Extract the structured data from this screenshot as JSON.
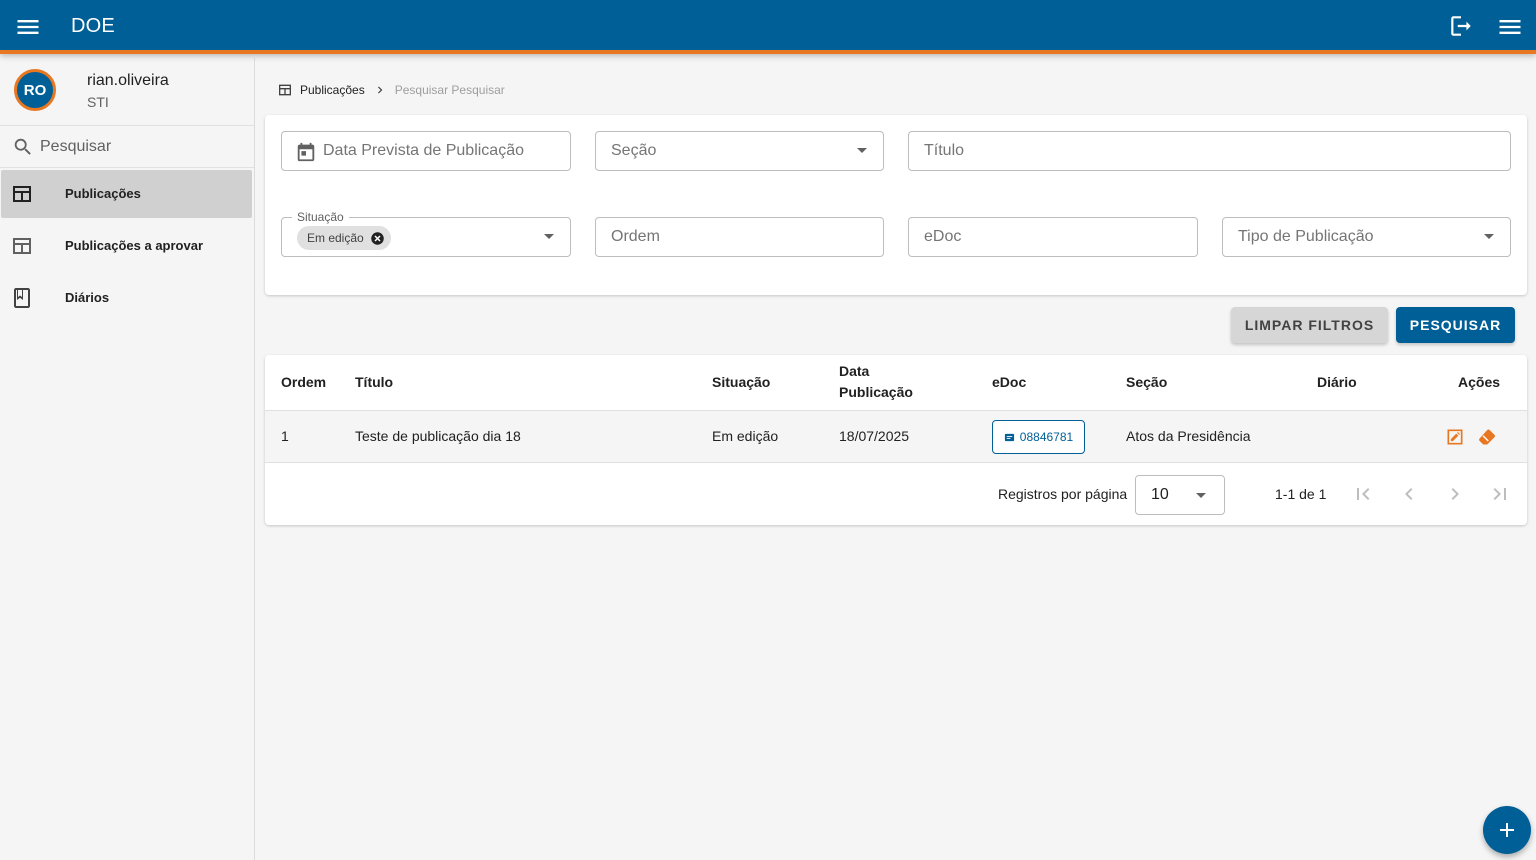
{
  "app": {
    "title": "DOE"
  },
  "colors": {
    "primary": "#005f96",
    "accent": "#e87722"
  },
  "user": {
    "initials": "RO",
    "name": "rian.oliveira",
    "org": "STI"
  },
  "sidebar": {
    "search_placeholder": "Pesquisar",
    "items": [
      {
        "label": "Publicações",
        "icon": "table-icon",
        "active": true
      },
      {
        "label": "Publicações a aprovar",
        "icon": "table-icon",
        "active": false
      },
      {
        "label": "Diários",
        "icon": "book-icon",
        "active": false
      }
    ]
  },
  "breadcrumb": {
    "parent": "Publicações",
    "current": "Pesquisar Pesquisar"
  },
  "filters": {
    "data_prevista": "Data Prevista de Publicação",
    "secao": "Seção",
    "titulo": "Título",
    "situacao_label": "Situação",
    "situacao_chip": "Em edição",
    "ordem": "Ordem",
    "edoc": "eDoc",
    "tipo": "Tipo de Publicação"
  },
  "buttons": {
    "clear": "LIMPAR FILTROS",
    "search": "PESQUISAR"
  },
  "table": {
    "headers": {
      "ordem": "Ordem",
      "titulo": "Título",
      "situacao": "Situação",
      "data_line1": "Data",
      "data_line2": "Publicação",
      "edoc": "eDoc",
      "secao": "Seção",
      "diario": "Diário",
      "acoes": "Ações"
    },
    "rows": [
      {
        "ordem": "1",
        "titulo": "Teste de publicação dia 18",
        "situacao": "Em edição",
        "data": "18/07/2025",
        "edoc": "08846781",
        "secao": "Atos da Presidência",
        "diario": ""
      }
    ]
  },
  "pagination": {
    "rows_label": "Registros por página",
    "rows_value": "10",
    "range": "1-1 de 1"
  }
}
